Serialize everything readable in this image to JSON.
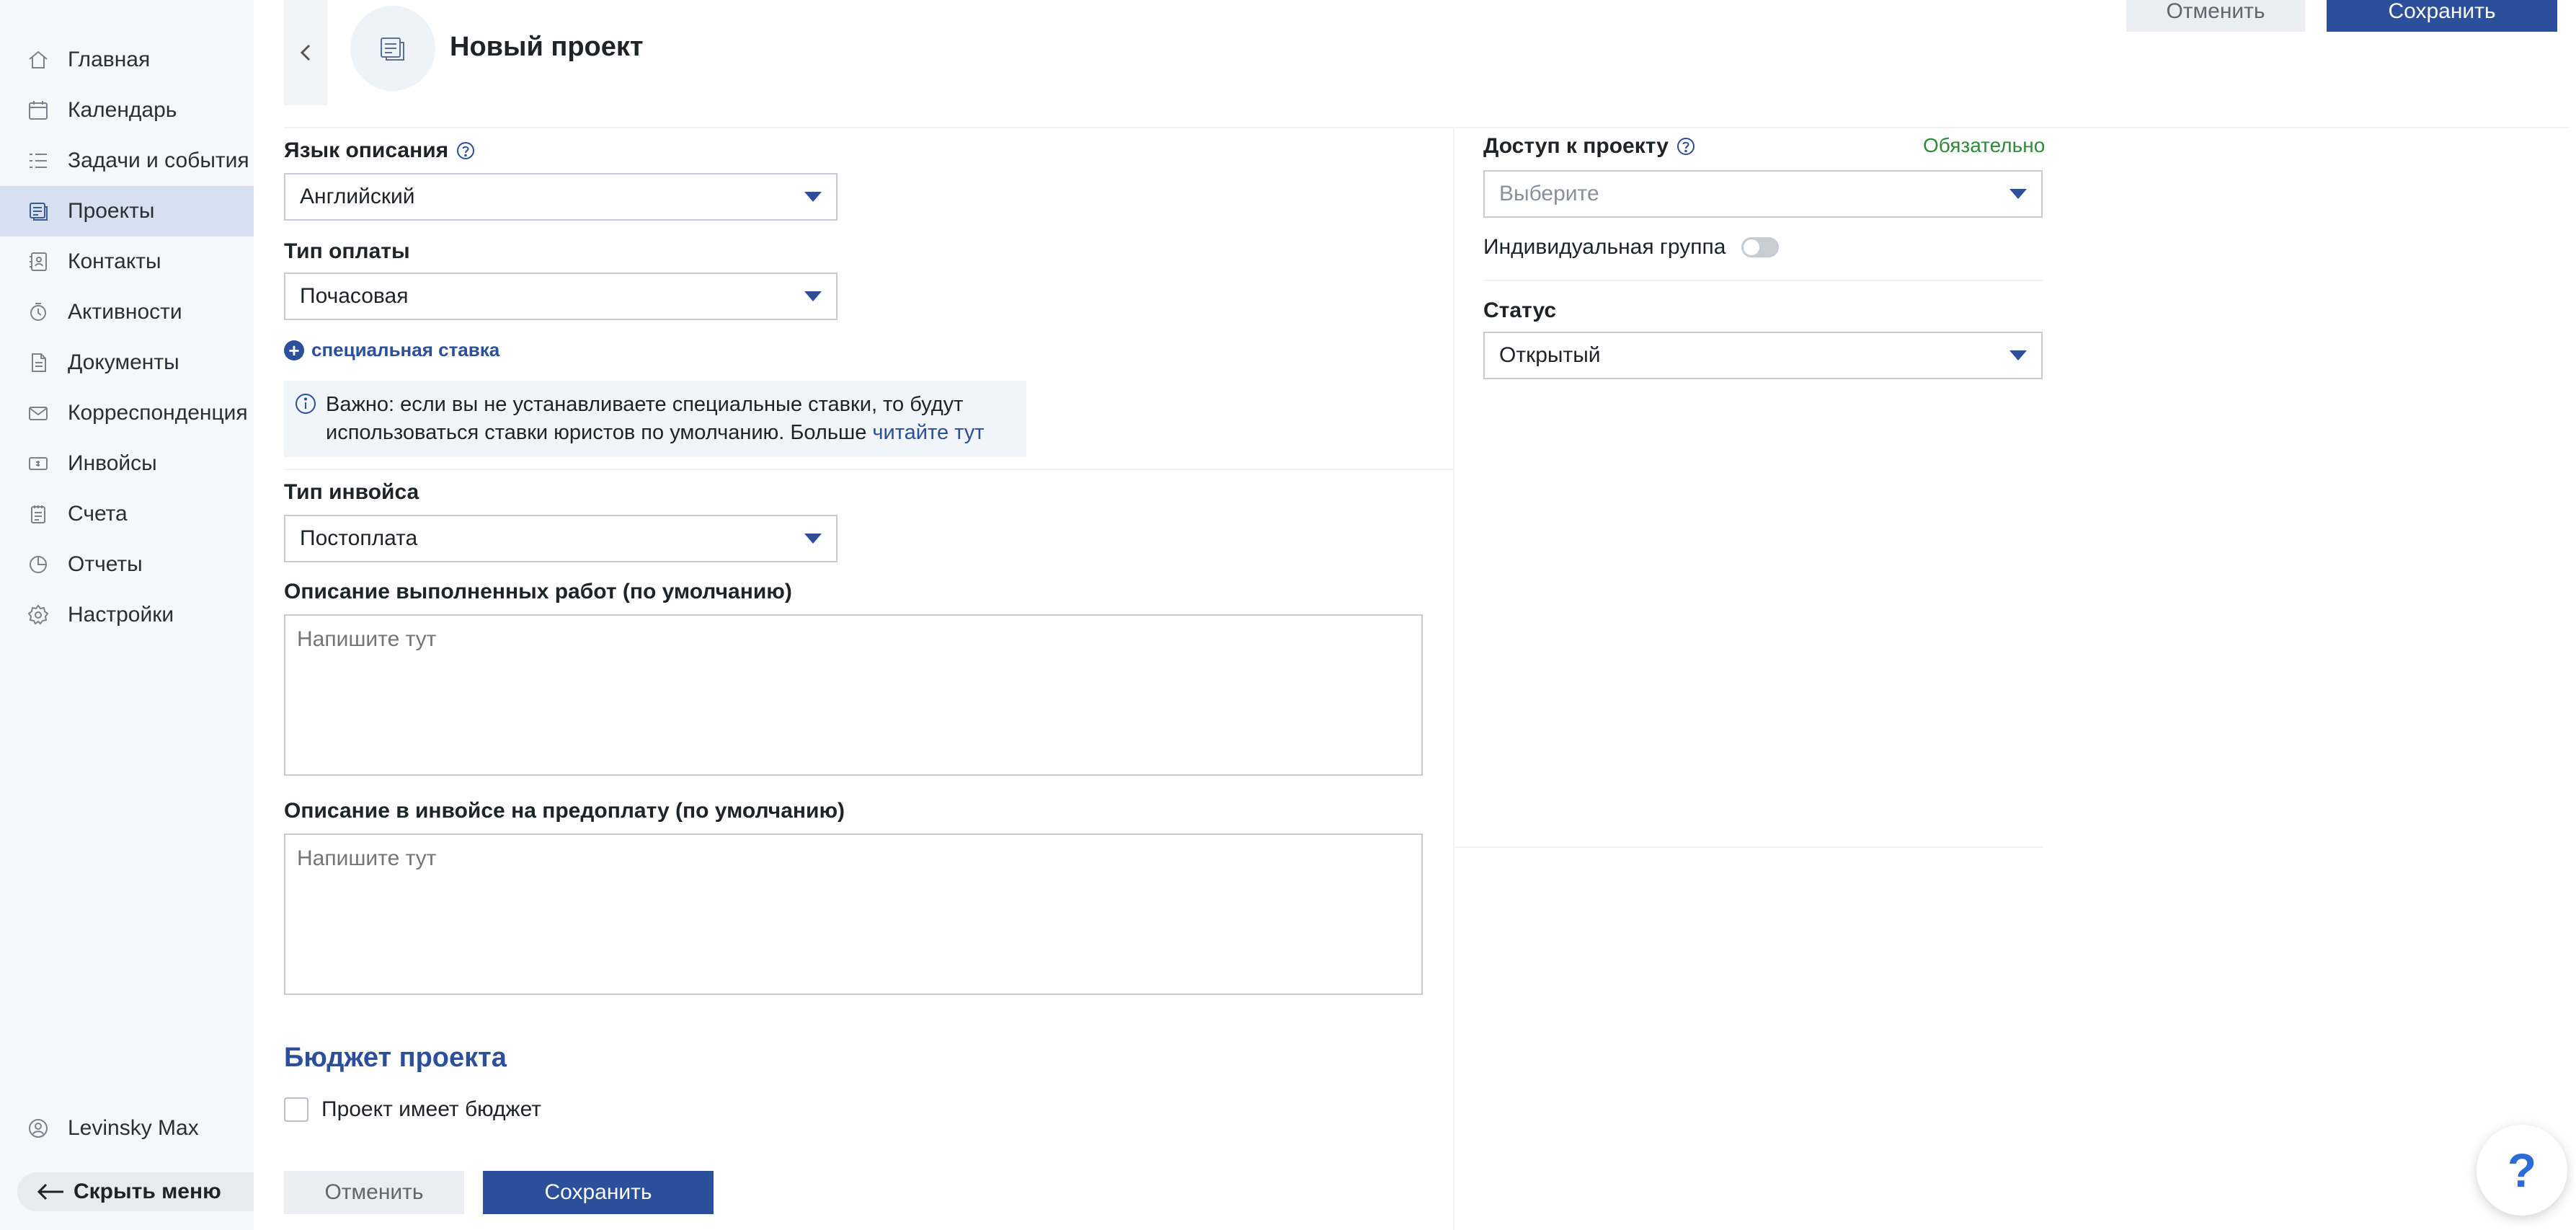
{
  "sidebar": {
    "items": [
      {
        "label": "Главная",
        "icon": "home-icon"
      },
      {
        "label": "Календарь",
        "icon": "calendar-icon"
      },
      {
        "label": "Задачи и события",
        "icon": "tasks-icon"
      },
      {
        "label": "Проекты",
        "icon": "projects-icon",
        "active": true
      },
      {
        "label": "Контакты",
        "icon": "contacts-icon"
      },
      {
        "label": "Активности",
        "icon": "activity-icon"
      },
      {
        "label": "Документы",
        "icon": "documents-icon"
      },
      {
        "label": "Корреспонденция",
        "icon": "mail-icon"
      },
      {
        "label": "Инвойсы",
        "icon": "invoice-icon"
      },
      {
        "label": "Счета",
        "icon": "accounts-icon"
      },
      {
        "label": "Отчеты",
        "icon": "reports-icon"
      },
      {
        "label": "Настройки",
        "icon": "settings-icon"
      }
    ],
    "user_name": "Levinsky Max",
    "hide_menu_label": "Скрыть меню"
  },
  "header": {
    "title": "Новый проект",
    "cancel_label": "Отменить",
    "save_label": "Сохранить"
  },
  "form": {
    "language": {
      "label": "Язык описания",
      "value": "Английский"
    },
    "payment_type": {
      "label": "Тип оплаты",
      "value": "Почасовая"
    },
    "special_rate_link": "специальная ставка",
    "notice": {
      "text": "Важно: если вы не устанавливаете специальные ставки, то будут использоваться ставки юристов по умолчанию. Больше ",
      "link": "читайте тут"
    },
    "invoice_type": {
      "label": "Тип инвойса",
      "value": "Постоплата"
    },
    "work_description": {
      "label": "Описание выполненных работ (по умолчанию)",
      "placeholder": "Напишите тут"
    },
    "prepay_description": {
      "label": "Описание в инвойсе на предоплату (по умолчанию)",
      "placeholder": "Напишите тут"
    },
    "budget": {
      "title": "Бюджет проекта",
      "checkbox_label": "Проект имеет бюджет"
    },
    "cancel_label": "Отменить",
    "save_label": "Сохранить"
  },
  "right_panel": {
    "access": {
      "label": "Доступ к проекту",
      "required": "Обязательно",
      "placeholder": "Выберите"
    },
    "individual_group": {
      "label": "Индивидуальная группа",
      "on": false
    },
    "status": {
      "label": "Статус",
      "value": "Открытый"
    }
  },
  "help_fab": "?",
  "colors": {
    "accent": "#2b4f9a",
    "required": "#2e8b3a",
    "sidebar_active": "#d7e0ee"
  }
}
